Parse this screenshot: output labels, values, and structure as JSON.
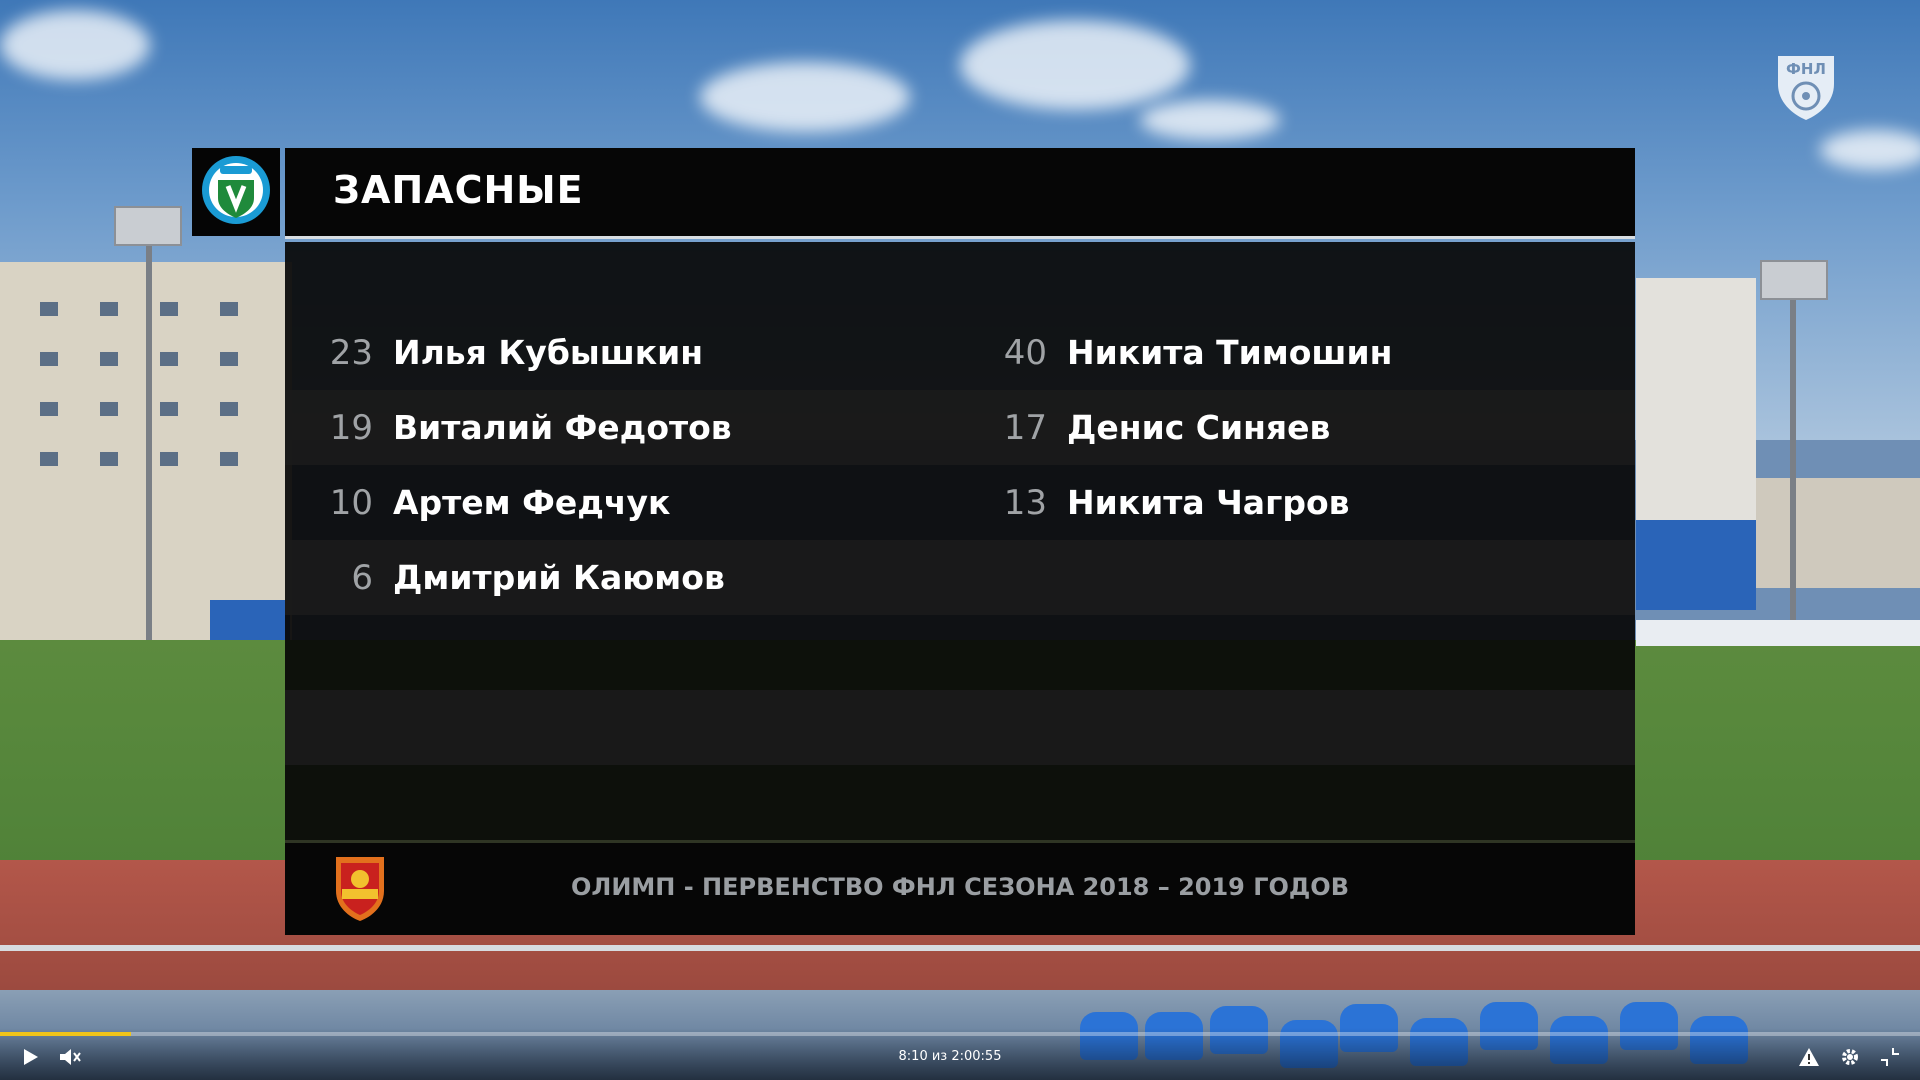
{
  "overlay": {
    "title": "ЗАПАСНЫЕ",
    "team_logo_icon": "avangard-club-crest-icon",
    "players_left": [
      {
        "number": "23",
        "name": "Илья Кубышкин"
      },
      {
        "number": "19",
        "name": "Виталий Федотов"
      },
      {
        "number": "10",
        "name": "Артем Федчук"
      },
      {
        "number": "6",
        "name": "Дмитрий Каюмов"
      }
    ],
    "players_right": [
      {
        "number": "40",
        "name": "Никита Тимошин"
      },
      {
        "number": "17",
        "name": "Денис Синяев"
      },
      {
        "number": "13",
        "name": "Никита Чагров"
      }
    ],
    "footer_caption": "ОЛИМП - ПЕРВЕНСТВО ФНЛ СЕЗОНА 2018 – 2019 ГОДОВ",
    "league_logo_icon": "olimp-fnl-shield-icon",
    "corner_logo_icon": "fnl-watermark-icon"
  },
  "player": {
    "time_readout": "8:10 из 2:00:55",
    "progress_fraction": 0.068,
    "play_icon": "play-icon",
    "mute_icon": "volume-muted-icon",
    "warning_icon": "warning-icon",
    "settings_icon": "gear-icon",
    "exit_fullscreen_icon": "exit-fullscreen-icon"
  },
  "colors": {
    "progress": "#f0c419",
    "panel": "#080808",
    "name_text": "#ffffff",
    "number_text": "#a0a3a6"
  }
}
